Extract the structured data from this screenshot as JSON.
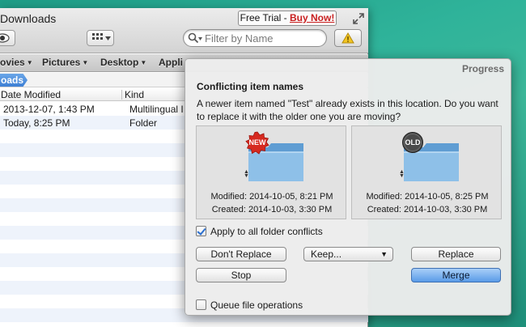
{
  "window": {
    "title": "Downloads",
    "trial_text": "Free Trial - ",
    "buy_now": "Buy Now!",
    "search_placeholder": "Filter by Name"
  },
  "favorites": [
    "ovies",
    "Pictures",
    "Desktop",
    "Appli"
  ],
  "breadcrumb": "oads",
  "columns": {
    "date_modified": "Date Modified",
    "kind": "Kind"
  },
  "files": [
    {
      "date": "2013-12-07, 1:43 PM",
      "kind": "Multilingual I"
    },
    {
      "date": "Today, 8:25 PM",
      "kind": "Folder"
    }
  ],
  "dialog": {
    "title": "Progress",
    "heading": "Conflicting item names",
    "message": "A newer item named \"Test\" already exists in this location. Do you want to replace it with the older one you are moving?",
    "new_item": {
      "badge": "NEW",
      "modified": "Modified: 2014-10-05, 8:21 PM",
      "created": "Created: 2014-10-03, 3:30 PM"
    },
    "old_item": {
      "badge": "OLD",
      "modified": "Modified: 2014-10-05, 8:25 PM",
      "created": "Created: 2014-10-03, 3:30 PM"
    },
    "apply_all": {
      "label": "Apply to all folder conflicts",
      "checked": true
    },
    "buttons": {
      "dont_replace": "Don't Replace",
      "keep": "Keep...",
      "replace": "Replace",
      "stop": "Stop",
      "merge": "Merge"
    },
    "queue": {
      "label": "Queue file operations",
      "checked": false
    }
  },
  "colors": {
    "desktop": "#2fb39a",
    "new_badge": "#d62a20",
    "old_badge": "#4a4a4a",
    "folder": "#7cb3e0",
    "primary_button": "#5a9be8",
    "buy_now": "#c81e1e"
  }
}
